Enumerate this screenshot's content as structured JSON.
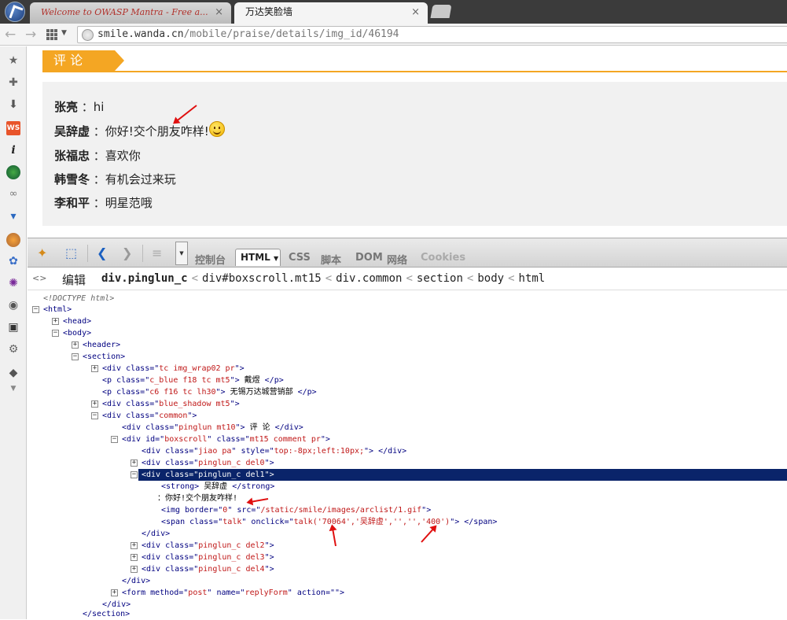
{
  "browser": {
    "tabs": [
      {
        "label": "Welcome to OWASP Mantra - Free a...",
        "close": "×"
      },
      {
        "label": "万达笑脸墙",
        "close": "×"
      }
    ],
    "url_prefix": "smile.wanda.cn",
    "url_path": "/mobile/praise/details/img_id/46194"
  },
  "page": {
    "section_title": "评 论",
    "comments": [
      {
        "name": "张亮",
        "text": "：hi",
        "emoticon": false
      },
      {
        "name": "吴辞虚",
        "text": "：你好!交个朋友咋样!",
        "emoticon": true
      },
      {
        "name": "张福忠",
        "text": "：喜欢你",
        "emoticon": false
      },
      {
        "name": "韩雪冬",
        "text": "：有机会过来玩",
        "emoticon": false
      },
      {
        "name": "李和平",
        "text": "：明星范哦",
        "emoticon": false
      }
    ]
  },
  "devtools": {
    "tabs": [
      "控制台",
      "HTML",
      "CSS",
      "脚本",
      "DOM",
      "网络",
      "Cookies"
    ],
    "active_tab_caret": "▼",
    "edit_label": "编辑",
    "breadcrumbs": [
      "div.pinglun_c",
      "div#boxscroll.mt15",
      "div.common",
      "section",
      "body",
      "html"
    ],
    "tree": {
      "doctype": "<!DOCTYPE html>",
      "l_html": "<html>",
      "l_head": "<head>",
      "l_body": "<body>",
      "l_header": "<header>",
      "l_section": "<section>",
      "div_wrap_cls": "tc img_wrap02 pr",
      "p1_cls": "c_blue f18 tc mt5",
      "p1_text": "戴煜",
      "p2_cls": "c6 f16 tc lh30",
      "p2_text": "无锡万达城营销部",
      "div_shadow_cls": "blue_shadow mt5",
      "div_common_cls": "common",
      "div_pinglun_cls": "pinglun mt10",
      "div_pinglun_text": "评 论",
      "boxscroll_id": "boxscroll",
      "boxscroll_cls": "mt15 comment pr",
      "jiao_cls": "jiao pa",
      "jiao_style": "top:-8px;left:10px;",
      "del0_cls": "pinglun_c del0",
      "del1_cls": "pinglun_c del1",
      "strong_text": "吴辞虚",
      "comment_text": "：你好!交个朋友咋样!",
      "img_border": "0",
      "img_src": "/static/smile/images/arclist/1.gif",
      "span_cls": "talk",
      "span_onclick": "talk('70064','吴辞虚','','','400')",
      "del2_cls": "pinglun_c del2",
      "del3_cls": "pinglun_c del3",
      "del4_cls": "pinglun_c del4",
      "form_method": "post",
      "form_name": "replyForm",
      "form_action": "",
      "close_div": "</div>",
      "close_section": "</section>"
    }
  },
  "colors": {
    "accent_orange": "#f4a623",
    "selection_bg": "#0a246a",
    "attr_value": "#c01818",
    "annotation_red": "#e01010"
  }
}
